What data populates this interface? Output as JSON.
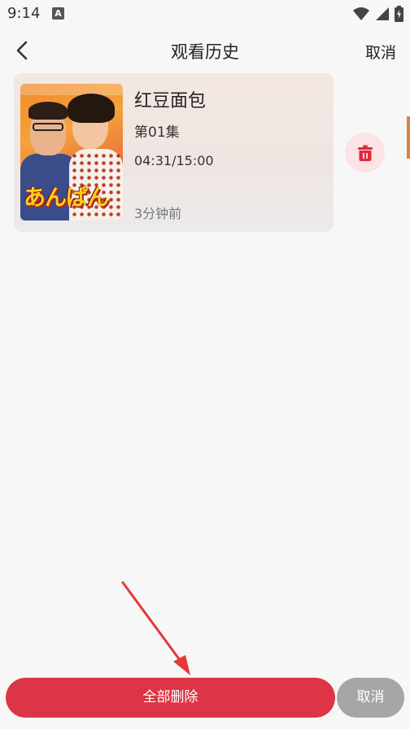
{
  "status_bar": {
    "time": "9:14",
    "notification_icon": "a-icon",
    "icons": [
      "wifi-icon",
      "signal-icon",
      "battery-charging-icon"
    ]
  },
  "nav": {
    "back_icon": "chevron-left-icon",
    "title": "观看历史",
    "cancel_label": "取消"
  },
  "history": [
    {
      "title": "红豆面包",
      "episode": "第01集",
      "progress_text": "04:31/15:00",
      "progress_fraction": 0.301,
      "time_ago": "3分钟前",
      "poster_logo_text": "あんぱん",
      "delete_icon": "trash-icon"
    }
  ],
  "bottom": {
    "delete_all_label": "全部删除",
    "cancel_label": "取消"
  },
  "colors": {
    "accent_red": "#dc3545",
    "delete_icon_bg": "#fbe3e6",
    "cancel_gray": "#a6a6a6",
    "annotation_arrow": "#e53935"
  }
}
